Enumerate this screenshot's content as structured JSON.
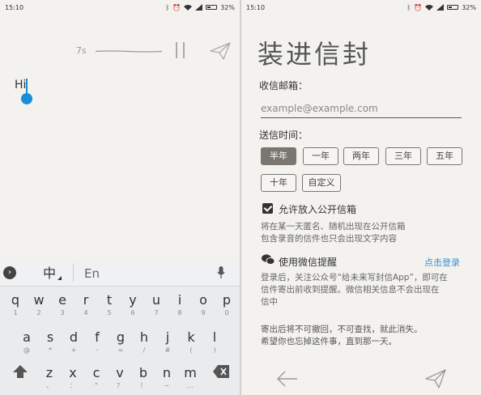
{
  "status_bar": {
    "time": "15:10",
    "battery": "32%",
    "icons": [
      "bluetooth-icon",
      "alarm-icon",
      "wifi-icon",
      "signal-icon",
      "battery-icon"
    ]
  },
  "recorder": {
    "elapsed": "7s",
    "letter_text": "Hi"
  },
  "keyboard": {
    "expand_icon": "chevron-right-icon",
    "lang_zh": "中",
    "lang_en": "En",
    "mic_icon": "mic-icon",
    "rows": [
      [
        {
          "main": "q",
          "sub": "1"
        },
        {
          "main": "w",
          "sub": "2"
        },
        {
          "main": "e",
          "sub": "3"
        },
        {
          "main": "r",
          "sub": "4"
        },
        {
          "main": "t",
          "sub": "5"
        },
        {
          "main": "y",
          "sub": "6"
        },
        {
          "main": "u",
          "sub": "7"
        },
        {
          "main": "i",
          "sub": "8"
        },
        {
          "main": "o",
          "sub": "9"
        },
        {
          "main": "p",
          "sub": "0"
        }
      ],
      [
        {
          "main": "a",
          "sub": "@"
        },
        {
          "main": "s",
          "sub": "*"
        },
        {
          "main": "d",
          "sub": "+"
        },
        {
          "main": "f",
          "sub": "-"
        },
        {
          "main": "g",
          "sub": "="
        },
        {
          "main": "h",
          "sub": "/"
        },
        {
          "main": "j",
          "sub": "#"
        },
        {
          "main": "k",
          "sub": "("
        },
        {
          "main": "l",
          "sub": ")"
        }
      ],
      [
        {
          "main": "z",
          "sub": "、"
        },
        {
          "main": "x",
          "sub": "："
        },
        {
          "main": "c",
          "sub": "“"
        },
        {
          "main": "v",
          "sub": "？"
        },
        {
          "main": "b",
          "sub": "！"
        },
        {
          "main": "n",
          "sub": "~"
        },
        {
          "main": "m",
          "sub": "…"
        }
      ]
    ]
  },
  "envelope": {
    "title": "装进信封",
    "email_label": "收信邮箱：",
    "email_placeholder": "example@example.com",
    "time_label": "送信时间：",
    "time_options": [
      "半年",
      "一年",
      "两年",
      "三年",
      "五年",
      "十年",
      "自定义"
    ],
    "selected_option": "半年",
    "public_box_label": "允许放入公开信箱",
    "public_box_checked": true,
    "public_box_note_1": "将在某一天匿名、随机出现在公开信箱",
    "public_box_note_2": "包含录音的信件也只会出现文字内容",
    "wechat_label": "使用微信提醒",
    "wechat_login": "点击登录",
    "wechat_note_1": "登录后，关注公众号“给未来写封信App”，即可在",
    "wechat_note_2": "信件寄出前收到提醒。微信相关信息不会出现在",
    "wechat_note_3": "信中",
    "warning_1": "寄出后将不可撤回，不可查找，就此消失。",
    "warning_2": "希望你也忘掉这件事，直到那一天。",
    "accent_color": "#3a8fd6"
  }
}
